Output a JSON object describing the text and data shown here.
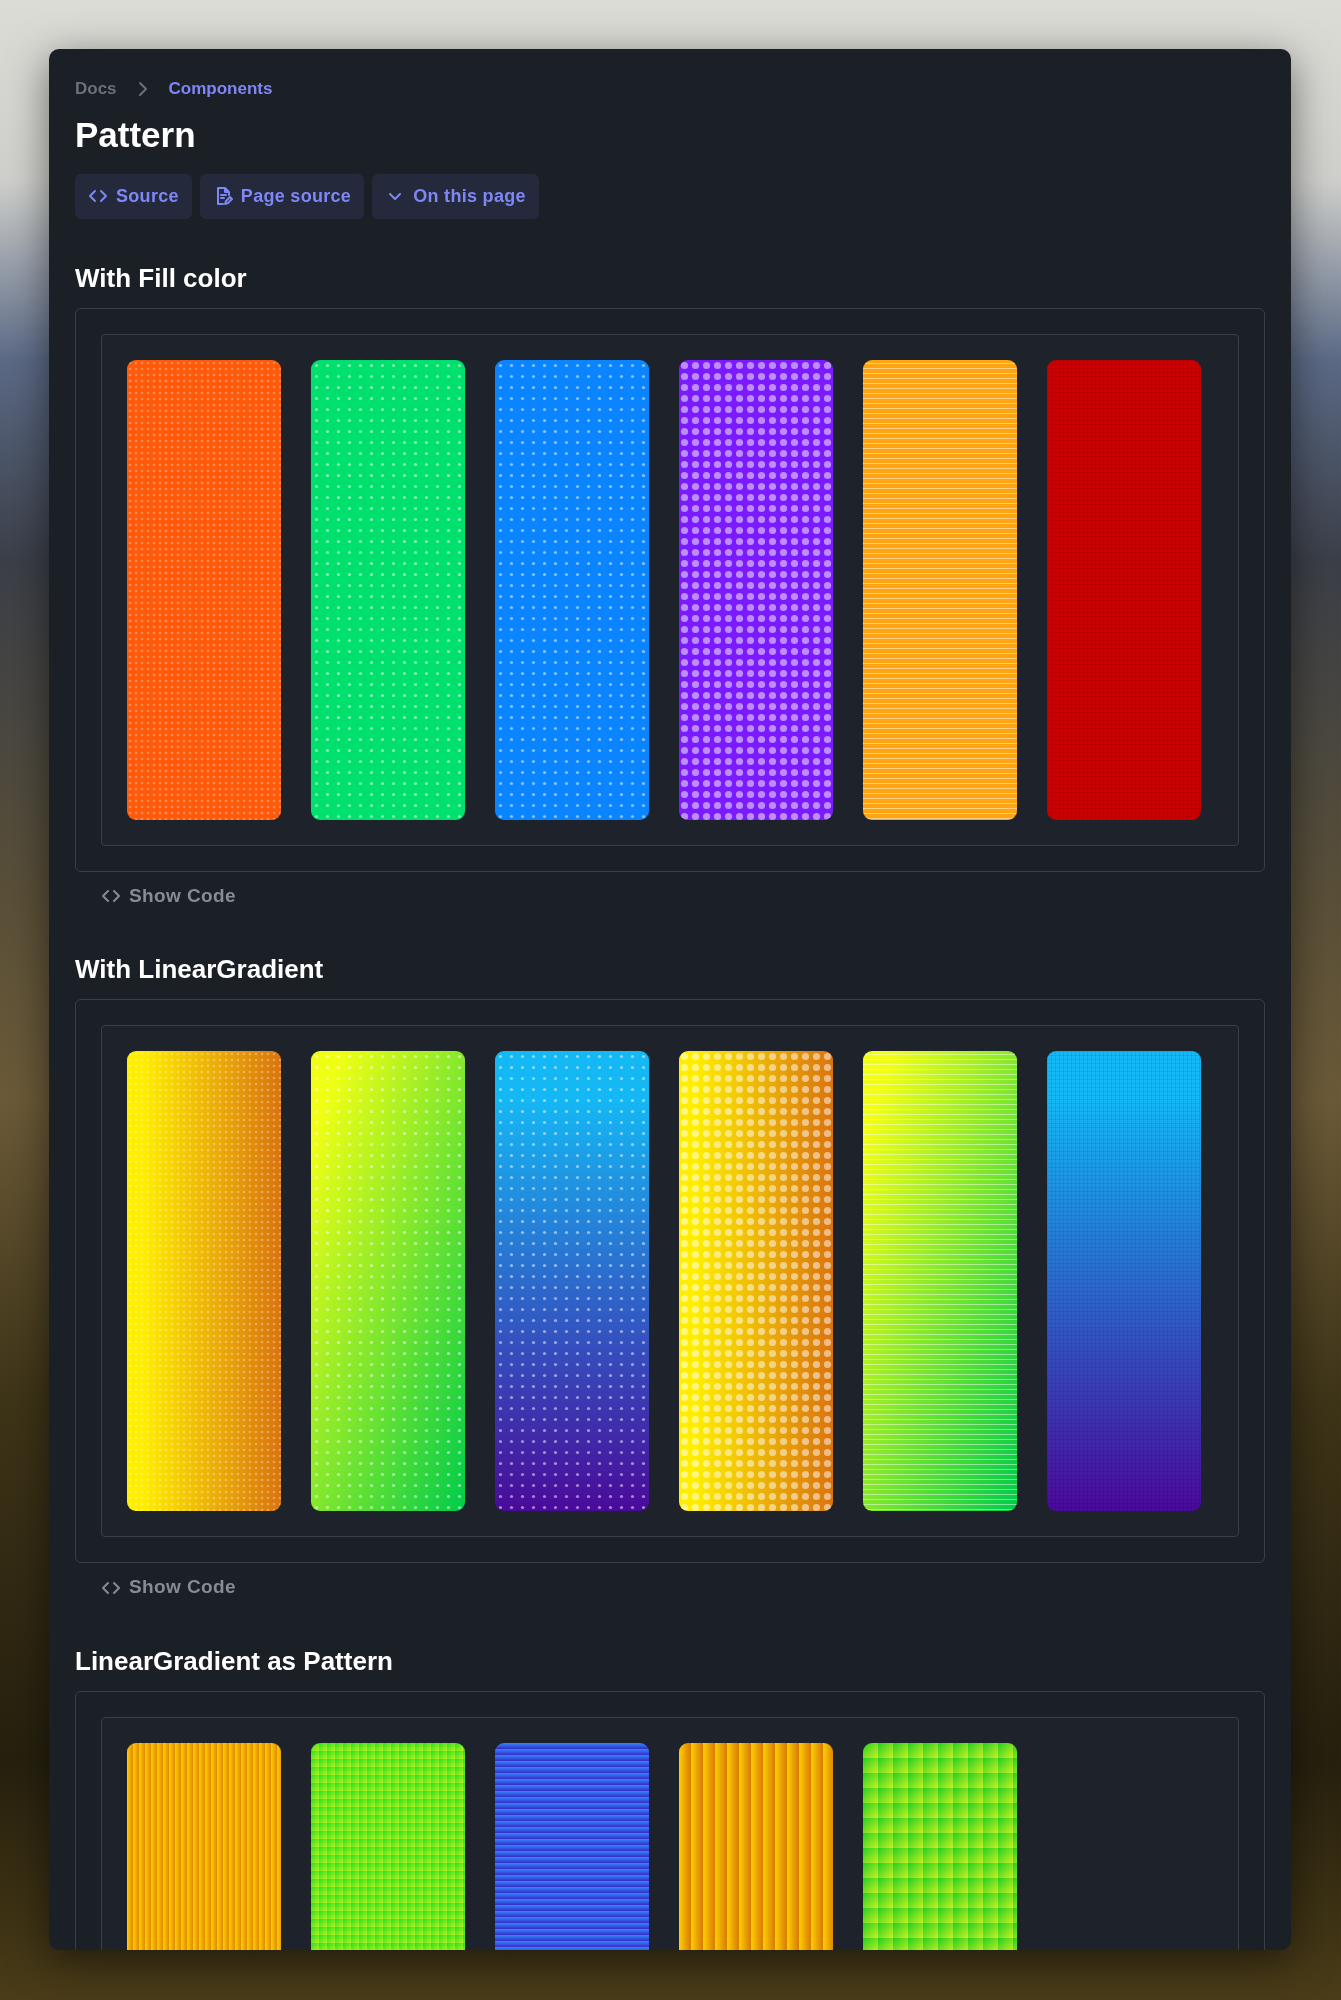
{
  "breadcrumb": [
    {
      "label": "Docs",
      "selected": false
    },
    {
      "label": "Components",
      "selected": true
    }
  ],
  "title": "Pattern",
  "toolbar": [
    {
      "kind": "code",
      "label": "Source"
    },
    {
      "kind": "document",
      "label": "Page source"
    },
    {
      "kind": "chevron",
      "label": "On this page"
    }
  ],
  "sections": [
    {
      "heading": "With Fill color",
      "kind": "fill",
      "show_code": "Show Code",
      "swatches": [
        {
          "kind": "fine-dots",
          "color": "#ff5a0a"
        },
        {
          "kind": "dots",
          "color": "#00e06c"
        },
        {
          "kind": "dots",
          "color": "#0a84ff"
        },
        {
          "kind": "large-dots",
          "color": "#7a1aff"
        },
        {
          "kind": "horizontal-lines",
          "color": "#ffa514"
        },
        {
          "kind": "fine-grid",
          "color": "#cc0000"
        }
      ]
    },
    {
      "heading": "With LinearGradient",
      "kind": "gradient",
      "show_code": "Show Code",
      "swatches": [
        {
          "kind": "fine-dots",
          "color": "#ffee00"
        },
        {
          "kind": "dots",
          "color": "#f0ff14"
        },
        {
          "kind": "dots",
          "color": "#14b8f5"
        },
        {
          "kind": "large-dots",
          "color": "#ffee00"
        },
        {
          "kind": "horizontal-lines",
          "color": "#f0ff14"
        },
        {
          "kind": "fine-grid",
          "color": "#14b8f5"
        }
      ]
    },
    {
      "heading": "LinearGradient as Pattern",
      "kind": "gradient-pattern",
      "swatches": [
        {
          "kind": "vertical-stripes",
          "color": "#ffd000"
        },
        {
          "kind": "checker",
          "color": "#22e022"
        },
        {
          "kind": "horizontal-stripes",
          "color": "#2a8cf5"
        },
        {
          "kind": "wide-vertical-stripes",
          "color": "#ffd000"
        },
        {
          "kind": "large-checker",
          "color": "#22d022"
        }
      ]
    }
  ]
}
